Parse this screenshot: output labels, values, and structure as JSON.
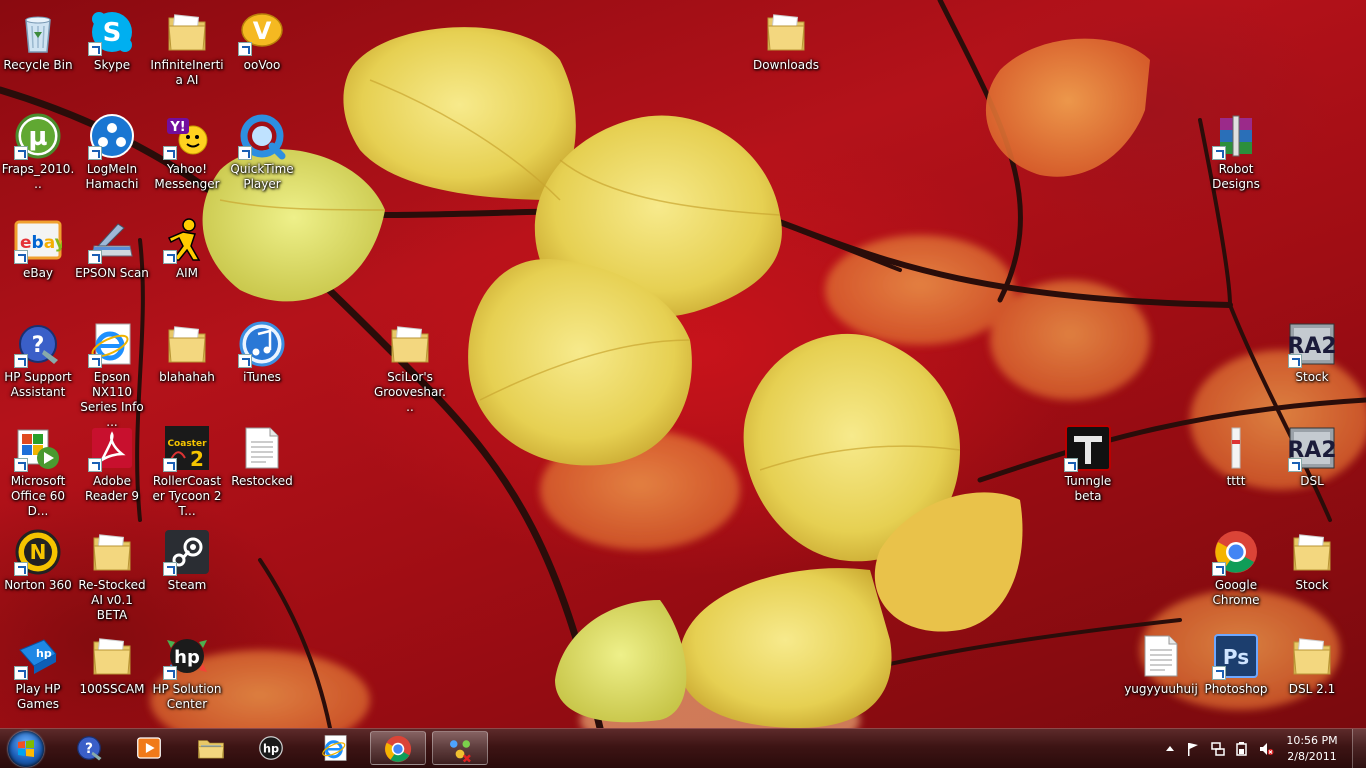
{
  "desktop": {
    "icons": [
      {
        "label": "Recycle Bin",
        "icon": "recycle-bin-icon"
      },
      {
        "label": "Skype",
        "icon": "skype-icon"
      },
      {
        "label": "InfiniteInertia AI",
        "icon": "folder-icon"
      },
      {
        "label": "ooVoo",
        "icon": "oovoo-icon"
      },
      {
        "label": "Downloads",
        "icon": "folder-icon"
      },
      {
        "label": "Fraps_2010...",
        "icon": "utorrent-icon"
      },
      {
        "label": "LogMeIn Hamachi",
        "icon": "hamachi-icon"
      },
      {
        "label": "Yahoo! Messenger",
        "icon": "yahoo-messenger-icon"
      },
      {
        "label": "QuickTime Player",
        "icon": "quicktime-icon"
      },
      {
        "label": "Robot Designs",
        "icon": "winrar-icon"
      },
      {
        "label": "eBay",
        "icon": "ebay-icon"
      },
      {
        "label": "EPSON Scan",
        "icon": "scanner-icon"
      },
      {
        "label": "AIM",
        "icon": "aim-icon"
      },
      {
        "label": "HP Support Assistant",
        "icon": "hp-support-icon"
      },
      {
        "label": "Epson NX110 Series Info ...",
        "icon": "internet-explorer-icon"
      },
      {
        "label": "blahahah",
        "icon": "folder-icon"
      },
      {
        "label": "iTunes",
        "icon": "itunes-icon"
      },
      {
        "label": "SciLor's Grooveshar...",
        "icon": "folder-icon"
      },
      {
        "label": "Stock",
        "icon": "ra2-icon"
      },
      {
        "label": "Microsoft Office 60 D...",
        "icon": "office-icon"
      },
      {
        "label": "Adobe Reader 9",
        "icon": "adobe-reader-icon"
      },
      {
        "label": "RollerCoaster Tycoon 2 T...",
        "icon": "rct2-icon"
      },
      {
        "label": "Restocked",
        "icon": "text-file-icon"
      },
      {
        "label": "Tunngle beta",
        "icon": "tunngle-icon"
      },
      {
        "label": "tttt",
        "icon": "tttt-icon"
      },
      {
        "label": "DSL",
        "icon": "ra2-icon"
      },
      {
        "label": "Norton 360",
        "icon": "norton-icon"
      },
      {
        "label": "Re-Stocked AI v0.1 BETA",
        "icon": "folder-icon"
      },
      {
        "label": "Steam",
        "icon": "steam-icon"
      },
      {
        "label": "Google Chrome",
        "icon": "chrome-icon"
      },
      {
        "label": "Stock",
        "icon": "folder-icon"
      },
      {
        "label": "Play HP Games",
        "icon": "hp-games-icon"
      },
      {
        "label": "100SSCAM",
        "icon": "folder-icon"
      },
      {
        "label": "HP Solution Center",
        "icon": "hp-solution-icon"
      },
      {
        "label": "yugyyuuhuij",
        "icon": "text-file-icon"
      },
      {
        "label": "Photoshop",
        "icon": "photoshop-icon"
      },
      {
        "label": "DSL 2.1",
        "icon": "folder-icon"
      }
    ]
  },
  "taskbar": {
    "start_icon": "windows-start-icon",
    "pinned": [
      {
        "name": "hp-support-assistant",
        "icon": "hp-support-icon",
        "active": false
      },
      {
        "name": "media-player",
        "icon": "media-player-icon",
        "active": false
      },
      {
        "name": "file-explorer",
        "icon": "file-explorer-icon",
        "active": false
      },
      {
        "name": "hp",
        "icon": "hp-icon",
        "active": false
      },
      {
        "name": "internet-explorer",
        "icon": "internet-explorer-icon",
        "active": false
      },
      {
        "name": "google-chrome",
        "icon": "chrome-icon",
        "active": true
      },
      {
        "name": "hamachi",
        "icon": "hamachi-network-icon",
        "active": true
      }
    ],
    "tray": {
      "icons": [
        "show-hidden-icons-icon",
        "action-center-flag-icon",
        "network-icon",
        "power-icon",
        "volume-muted-icon"
      ],
      "time": "10:56 PM",
      "date": "2/8/2011"
    }
  },
  "colors": {
    "wallpaper_red": "#b4121a",
    "leaf_yellow": "#e8d35a",
    "leaf_orange": "#e27a2a",
    "taskbar": "#3d1414"
  }
}
